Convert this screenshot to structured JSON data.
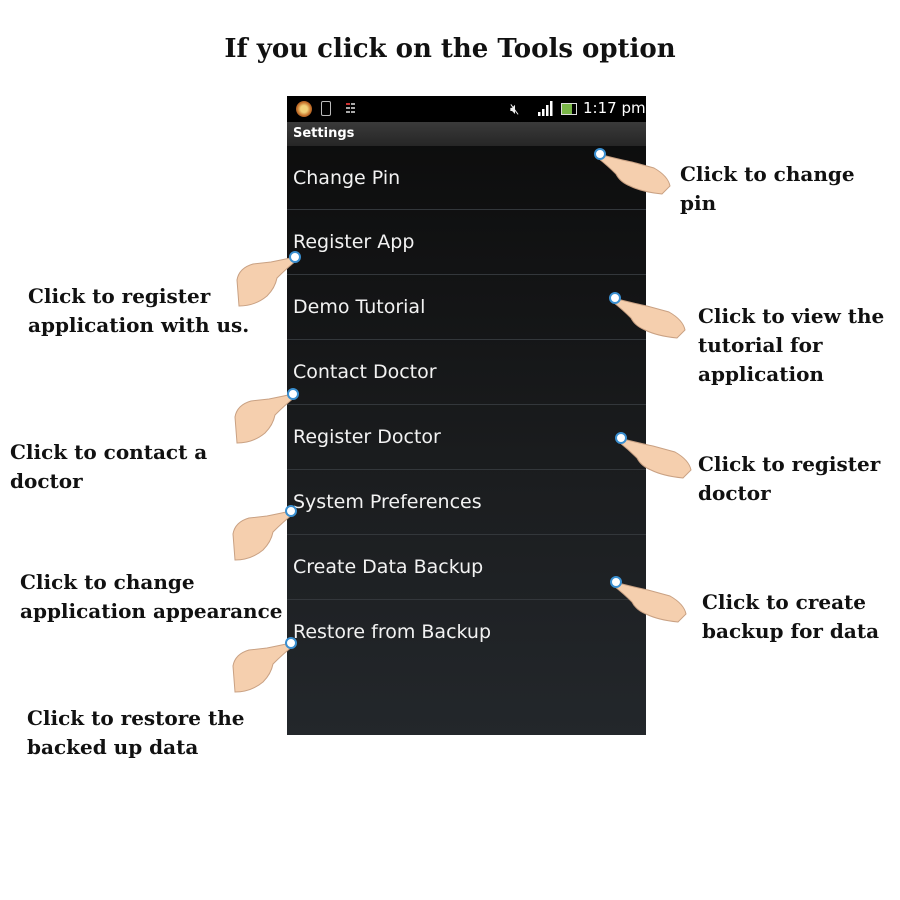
{
  "page_title": "If you click on the Tools option",
  "status_bar": {
    "time": "1:17 pm",
    "icons": [
      "app-notification-icon",
      "phone-icon",
      "signal-data-icon",
      "mute-icon",
      "signal-bars-icon",
      "battery-icon"
    ]
  },
  "screen": {
    "header_title": "Settings",
    "menu_items": [
      "Change Pin",
      "Register App",
      "Demo Tutorial",
      "Contact Doctor",
      "Register Doctor",
      "System Preferences",
      "Create Data Backup",
      "Restore from Backup"
    ]
  },
  "callouts": {
    "change_pin": "Click to change\n pin",
    "register_app": "Click to register\napplication with us.",
    "demo_tutorial": "Click to view the\ntutorial for\napplication",
    "contact_doctor": "Click to contact a\ndoctor",
    "register_doctor": "Click to register\ndoctor",
    "system_preferences": "Click to change\napplication appearance",
    "create_backup": "Click to create\nbackup for  data",
    "restore_backup": "Click to restore the\nbacked up data"
  },
  "colors": {
    "phone_background": "#1b1d1f",
    "status_bar": "#000000",
    "text_light": "#f2f2f2",
    "callout_text": "#111111",
    "hand_skin": "#f5cfae"
  }
}
